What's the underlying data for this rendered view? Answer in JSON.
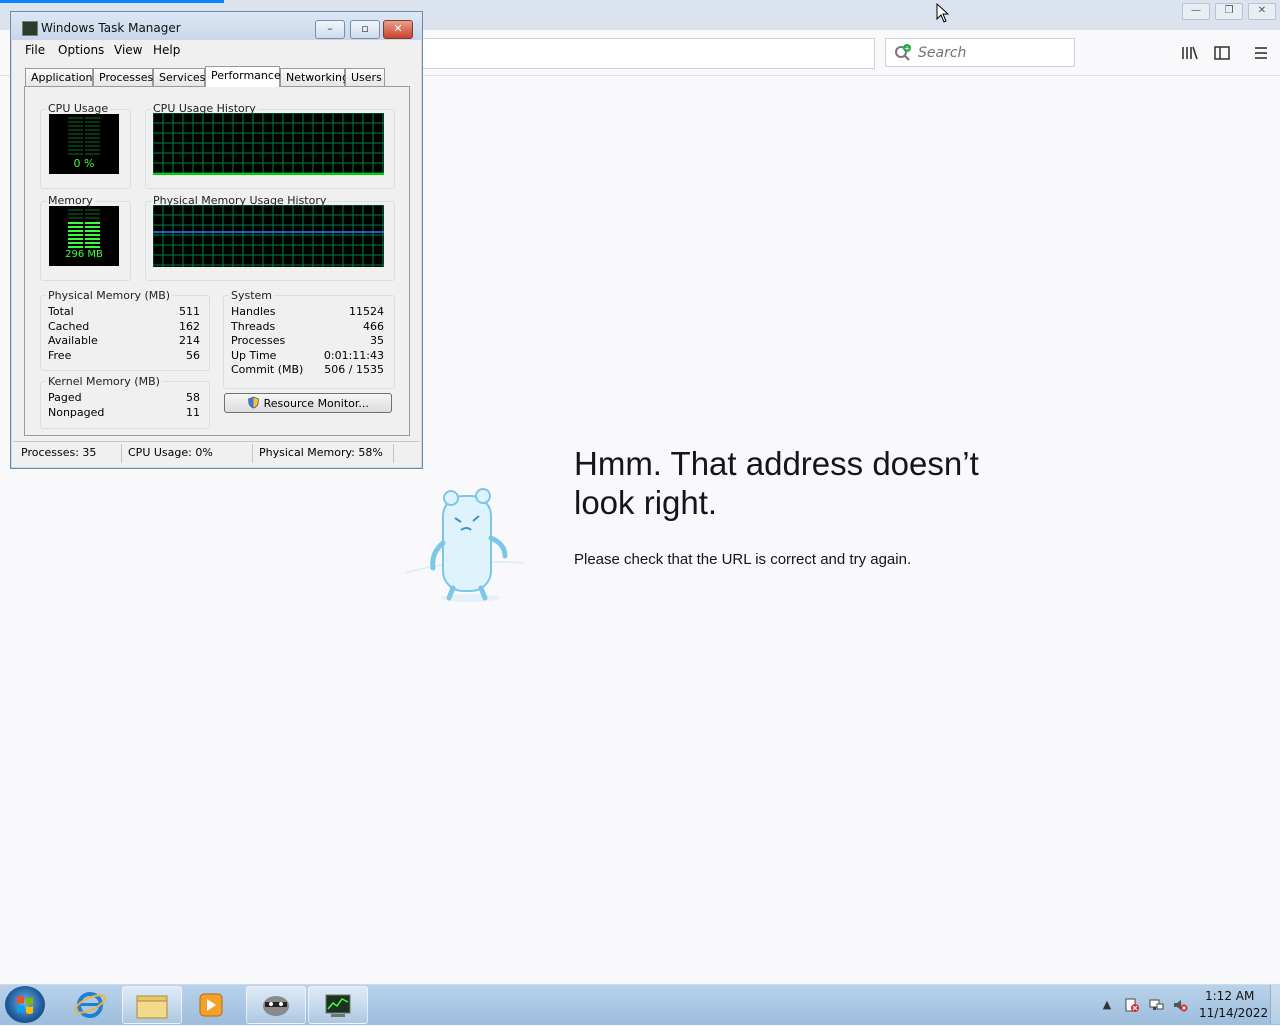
{
  "browser": {
    "search_placeholder": "Search",
    "controls": {
      "minimize": "—",
      "restore": "❐",
      "close": "✕"
    },
    "toolbar_icons": [
      "library-icon",
      "sidebar-icon",
      "menu-icon"
    ]
  },
  "error_page": {
    "title": "Hmm. That address doesn’t look right.",
    "description": "Please check that the URL is correct and try again."
  },
  "task_manager": {
    "title": "Windows Task Manager",
    "menu": [
      "File",
      "Options",
      "View",
      "Help"
    ],
    "tabs": [
      "Applications",
      "Processes",
      "Services",
      "Performance",
      "Networking",
      "Users"
    ],
    "active_tab": "Performance",
    "cpu_usage_label": "CPU Usage",
    "cpu_usage_value": "0 %",
    "cpu_history_label": "CPU Usage History",
    "memory_label": "Memory",
    "memory_value": "296 MB",
    "mem_history_label": "Physical Memory Usage History",
    "physical_memory": {
      "label": "Physical Memory (MB)",
      "rows": [
        {
          "k": "Total",
          "v": "511"
        },
        {
          "k": "Cached",
          "v": "162"
        },
        {
          "k": "Available",
          "v": "214"
        },
        {
          "k": "Free",
          "v": "56"
        }
      ]
    },
    "kernel_memory": {
      "label": "Kernel Memory (MB)",
      "rows": [
        {
          "k": "Paged",
          "v": "58"
        },
        {
          "k": "Nonpaged",
          "v": "11"
        }
      ]
    },
    "system": {
      "label": "System",
      "rows": [
        {
          "k": "Handles",
          "v": "11524"
        },
        {
          "k": "Threads",
          "v": "466"
        },
        {
          "k": "Processes",
          "v": "35"
        },
        {
          "k": "Up Time",
          "v": "0:01:11:43"
        },
        {
          "k": "Commit (MB)",
          "v": "506 / 1535"
        }
      ]
    },
    "resource_monitor_button": "Resource Monitor...",
    "status": {
      "processes": "Processes: 35",
      "cpu": "CPU Usage: 0%",
      "memory": "Physical Memory: 58%"
    }
  },
  "taskbar": {
    "time": "1:12 AM",
    "date": "11/14/2022",
    "items": [
      "ie-icon",
      "explorer-icon",
      "media-player-icon",
      "firefox-icon",
      "task-manager-icon"
    ]
  },
  "colors": {
    "accent": "#0a84ff",
    "graph_grid": "#00803c",
    "graph_line": "#00ff00",
    "memory_line": "#2f7fff"
  }
}
